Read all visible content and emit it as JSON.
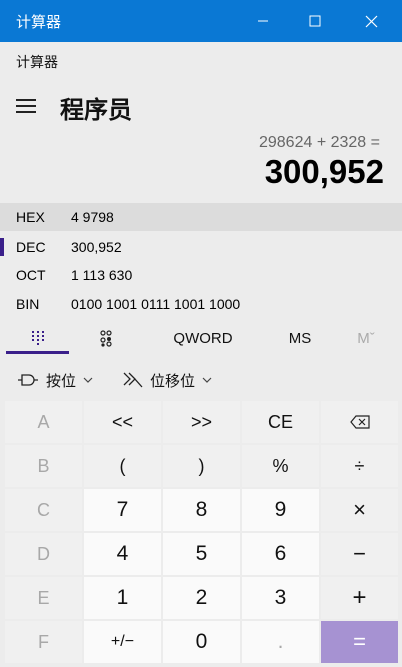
{
  "window": {
    "title": "计算器",
    "controls": {
      "minimize": "minimize-icon",
      "maximize": "maximize-icon",
      "close": "close-icon"
    }
  },
  "app": {
    "header_label": "计算器",
    "mode_title": "程序员"
  },
  "display": {
    "expression": "298624 + 2328 =",
    "result": "300,952"
  },
  "radix": [
    {
      "label": "HEX",
      "value": "4 9798"
    },
    {
      "label": "DEC",
      "value": "300,952"
    },
    {
      "label": "OCT",
      "value": "1 113 630"
    },
    {
      "label": "BIN",
      "value": "0100 1001 0111 1001 1000"
    }
  ],
  "tabs": {
    "keypad_icon": "full-keypad-icon",
    "bit_icon": "bit-toggle-icon",
    "word_size": "QWORD",
    "memory_store": "MS",
    "memory_recall": "Mˇ"
  },
  "operations": {
    "bitwise_label": "按位",
    "bitshift_label": "位移位"
  },
  "keys": [
    [
      "A",
      "<<",
      ">>",
      "CE",
      "⌫"
    ],
    [
      "B",
      "(",
      ")",
      "%",
      "÷"
    ],
    [
      "C",
      "7",
      "8",
      "9",
      "×"
    ],
    [
      "D",
      "4",
      "5",
      "6",
      "−"
    ],
    [
      "E",
      "1",
      "2",
      "3",
      "+"
    ],
    [
      "F",
      "+/−",
      "0",
      ".",
      "="
    ]
  ],
  "colors": {
    "titlebar": "#0a78d4",
    "accent": "#3a1f8a",
    "equals": "#a692d2"
  }
}
